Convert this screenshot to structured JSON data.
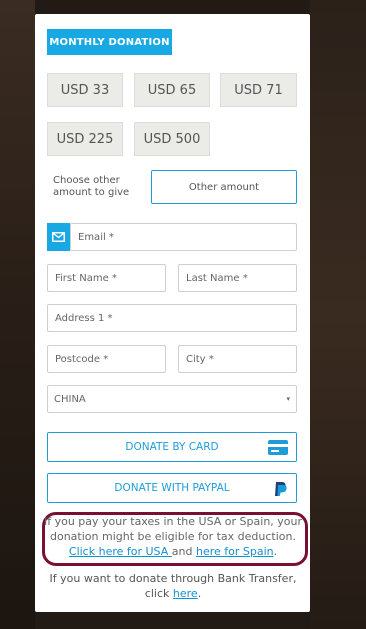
{
  "tab": {
    "label": "MONTHLY DONATION"
  },
  "amounts": [
    "USD 33",
    "USD 65",
    "USD 71",
    "USD 225",
    "USD 500"
  ],
  "other": {
    "label": "Choose other amount to give",
    "placeholder": "Other amount"
  },
  "form": {
    "email": "Email *",
    "first_name": "First Name *",
    "last_name": "Last Name *",
    "address": "Address 1 *",
    "postcode": "Postcode *",
    "city": "City *",
    "country": "CHINA"
  },
  "buttons": {
    "card": "DONATE BY CARD",
    "paypal": "DONATE WITH PAYPAL"
  },
  "tax": {
    "line1": "If you pay your taxes in the USA or Spain, your donation might be eligible for tax deduction.",
    "usa_link": "Click here for USA ",
    "and": "and ",
    "spain_link": "here for Spain",
    "end": "."
  },
  "bank": {
    "text": "If you want to donate through Bank Transfer, click ",
    "link": "here",
    "end": "."
  },
  "colors": {
    "accent": "#18a8e3",
    "highlight": "#7a1030"
  }
}
